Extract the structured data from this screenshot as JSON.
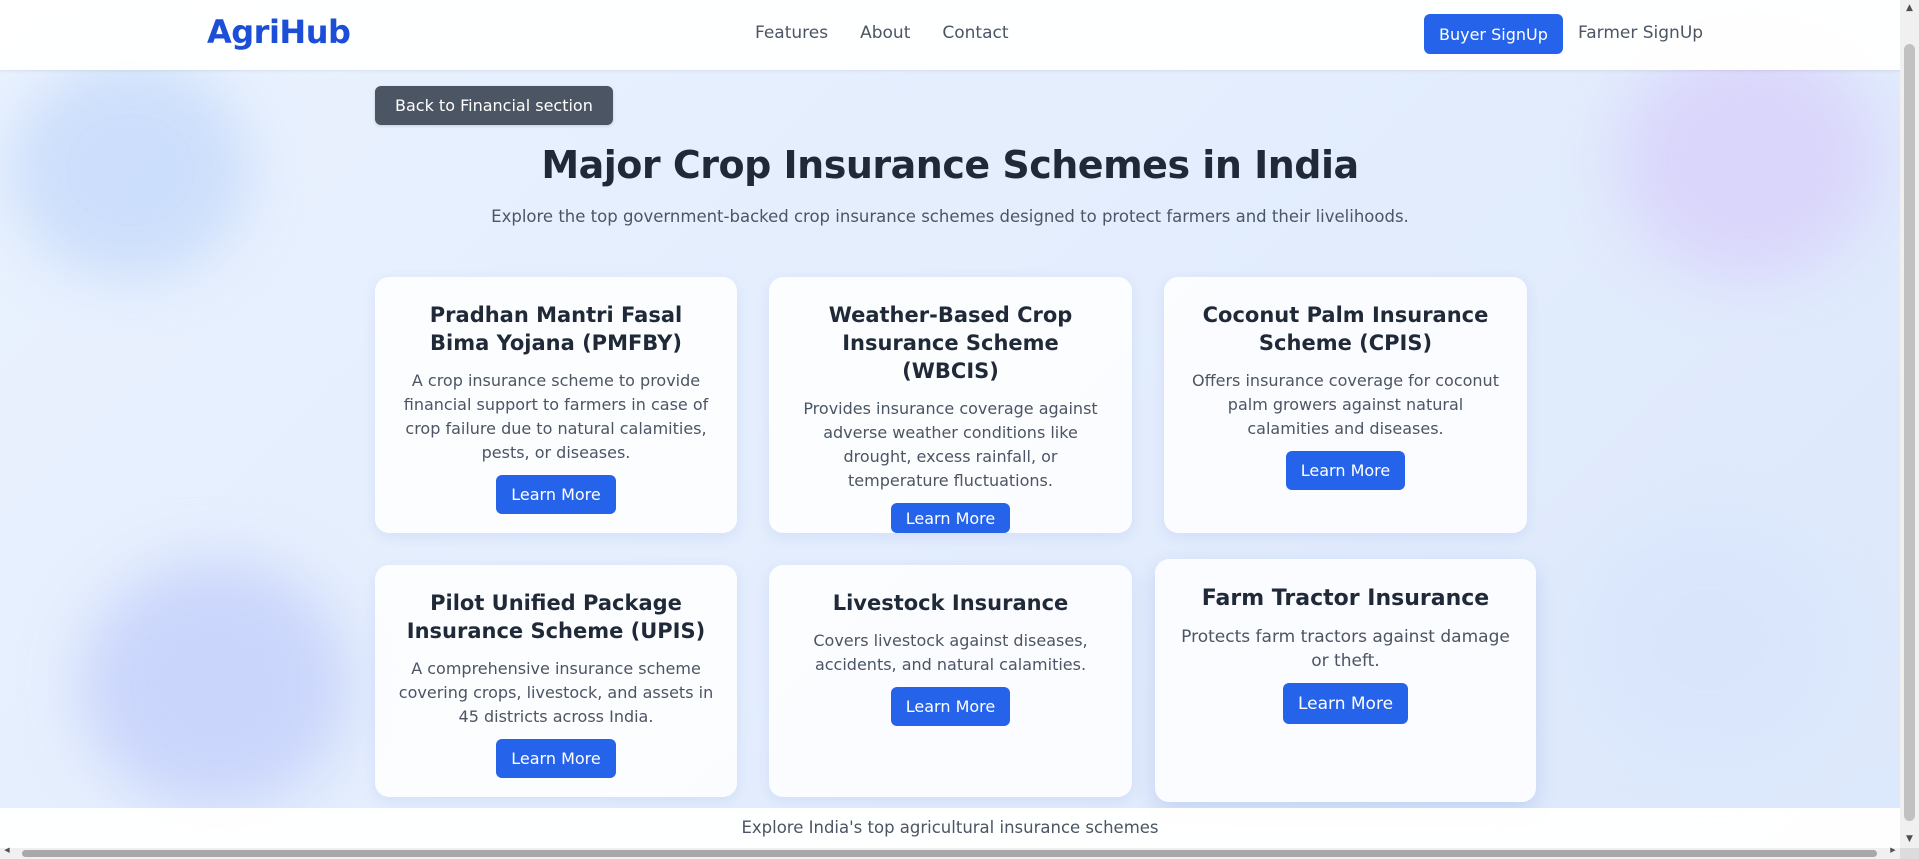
{
  "navbar": {
    "logo": "AgriHub",
    "links": [
      "Features",
      "About",
      "Contact"
    ],
    "buyer_signup": "Buyer SignUp",
    "farmer_signup": "Farmer SignUp"
  },
  "back_button": "Back to Financial section",
  "header": {
    "title": "Major Crop Insurance Schemes in India",
    "subtitle": "Explore the top government-backed crop insurance schemes designed to protect farmers and their livelihoods."
  },
  "cards": [
    {
      "title": "Pradhan Mantri Fasal Bima Yojana (PMFBY)",
      "description": "A crop insurance scheme to provide financial support to farmers in case of crop failure due to natural calamities, pests, or diseases.",
      "button": "Learn More"
    },
    {
      "title": "Weather-Based Crop Insurance Scheme (WBCIS)",
      "description": "Provides insurance coverage against adverse weather conditions like drought, excess rainfall, or temperature fluctuations.",
      "button": "Learn More"
    },
    {
      "title": "Coconut Palm Insurance Scheme (CPIS)",
      "description": "Offers insurance coverage for coconut palm growers against natural calamities and diseases.",
      "button": "Learn More"
    },
    {
      "title": "Pilot Unified Package Insurance Scheme (UPIS)",
      "description": "A comprehensive insurance scheme covering crops, livestock, and assets in 45 districts across India.",
      "button": "Learn More"
    },
    {
      "title": "Livestock Insurance",
      "description": "Covers livestock against diseases, accidents, and natural calamities.",
      "button": "Learn More"
    },
    {
      "title": "Farm Tractor Insurance",
      "description": "Protects farm tractors against damage or theft.",
      "button": "Learn More"
    }
  ],
  "footer": {
    "text": "Explore India's top agricultural insurance schemes"
  },
  "colors": {
    "brand": "#1d4ed8",
    "primary_button": "#2563eb",
    "back_button": "#4b5563",
    "heading": "#1f2937",
    "body_text": "#4b5563"
  },
  "icons": {
    "scroll_up": "arrow-up-icon",
    "scroll_down": "arrow-down-icon",
    "scroll_left": "arrow-left-icon",
    "scroll_right": "arrow-right-icon"
  }
}
